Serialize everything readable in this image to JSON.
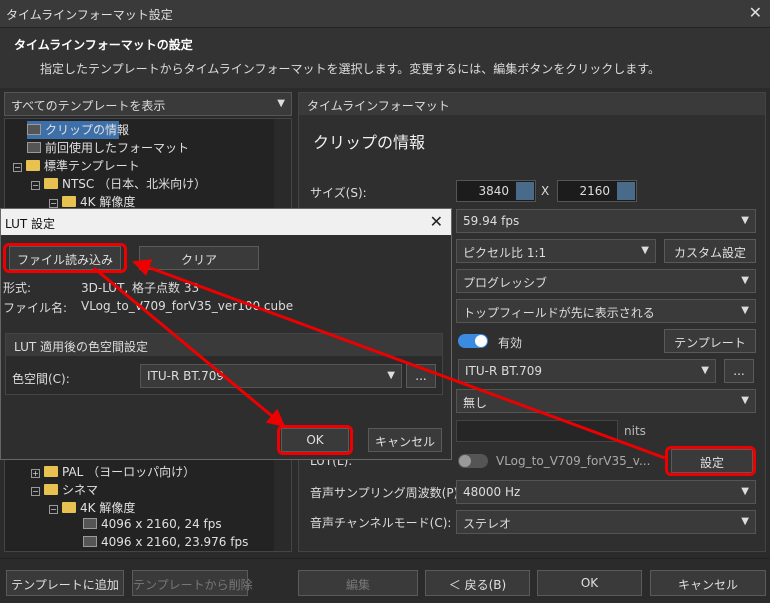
{
  "window": {
    "title": "タイムラインフォーマット設定",
    "close": "✕"
  },
  "header": {
    "title": "タイムラインフォーマットの設定",
    "desc": "指定したテンプレートからタイムラインフォーマットを選択します。変更するには、編集ボタンをクリックします。"
  },
  "filter": {
    "value": "すべてのテンプレートを表示"
  },
  "tree": {
    "items": [
      {
        "label": "クリップの情報"
      },
      {
        "label": "前回使用したフォーマット"
      },
      {
        "label": "標準テンプレート"
      },
      {
        "label": "NTSC （日本、北米向け）"
      },
      {
        "label": "4K 解像度"
      },
      {
        "label": "PAL （ヨーロッパ向け）"
      },
      {
        "label": "シネマ"
      },
      {
        "label": "4K 解像度"
      },
      {
        "label": "4096 x 2160, 24 fps"
      },
      {
        "label": "4096 x 2160, 23.976 fps"
      }
    ]
  },
  "panel": {
    "title": "タイムラインフォーマット",
    "heading": "クリップの情報",
    "size_label": "サイズ(S):",
    "width": "3840",
    "x": "X",
    "height": "2160",
    "framerate": "59.94 fps",
    "aspect": "ピクセル比 1:1",
    "custom_btn": "カスタム設定",
    "scan": "プログレッシブ",
    "field": "トップフィールドが先に表示される",
    "enabled": "有効",
    "template_btn": "テンプレート",
    "colorspace": "ITU-R BT.709",
    "more": "...",
    "none": "無し",
    "nits": "nits",
    "lut_label": "LUT(L):",
    "lut_file": "VLog_to_V709_forV35_v...",
    "settings_btn": "設定",
    "sample_label": "音声サンプリング周波数(P):",
    "sample_value": "48000 Hz",
    "channel_label": "音声チャンネルモード(C):",
    "channel_value": "ステレオ"
  },
  "lut_dialog": {
    "title": "LUT 設定",
    "load_btn": "ファイル読み込み",
    "clear_btn": "クリア",
    "format_label": "形式:",
    "format_value": "3D-LUT, 格子点数 33",
    "file_label": "ファイル名:",
    "file_value": "VLog_to_V709_forV35_ver100.cube",
    "group_title": "LUT 適用後の色空間設定",
    "cs_label": "色空間(C):",
    "cs_value": "ITU-R BT.709",
    "more": "...",
    "ok": "OK",
    "cancel": "キャンセル"
  },
  "footer": {
    "add_template": "テンプレートに追加",
    "remove_template": "テンプレートから削除",
    "edit": "編集",
    "back": "＜ 戻る(B)",
    "ok": "OK",
    "cancel": "キャンセル"
  },
  "colors": {
    "annotation": "#e00000",
    "selection": "#3d6fa8",
    "toggle_on": "#3b8be0"
  }
}
